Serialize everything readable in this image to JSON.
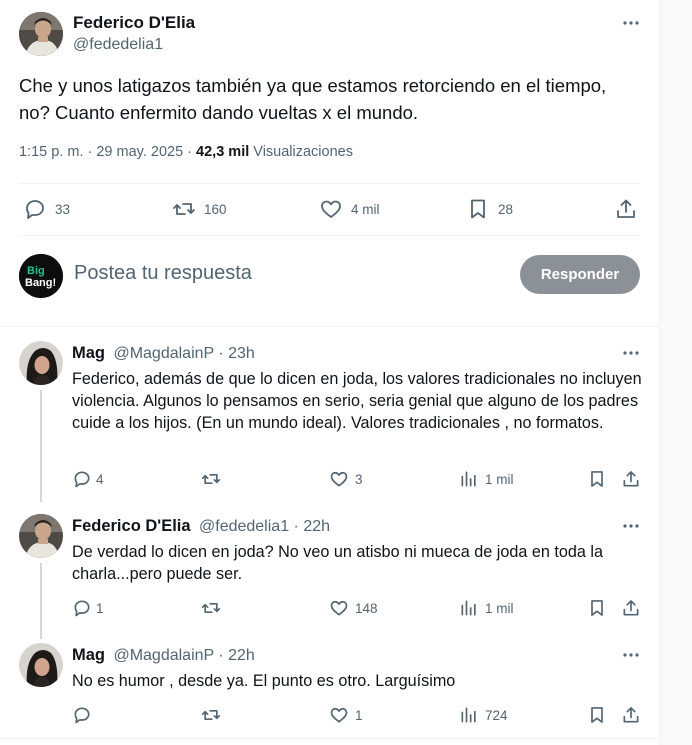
{
  "main_post": {
    "author_name": "Federico D'Elia",
    "author_handle": "@fededelia1",
    "text": "Che y unos latigazos también ya que estamos retorciendo en el tiempo, no? Cuanto enfermito dando vueltas x el mundo.",
    "time": "1:15 p. m. · 29 may. 2025 · ",
    "views_count": "42,3 mil",
    "views_label": " Visualizaciones",
    "replies": "33",
    "reposts": "160",
    "likes": "4 mil",
    "bookmarks": "28"
  },
  "reply_box": {
    "placeholder": "Postea tu respuesta",
    "button_label": "Responder",
    "avatar_logo_line1": "Big",
    "avatar_logo_line2": "Bang!"
  },
  "replies": [
    {
      "name": "Mag",
      "handle": "@MagdalainP",
      "time": " · 23h",
      "text": "Federico, además de que lo dicen en joda, los valores tradicionales no incluyen violencia. Algunos lo pensamos en serio, seria genial que alguno de los padres cuide a los hijos. (En un mundo ideal). Valores tradicionales , no formatos.",
      "replies": "4",
      "reposts": "",
      "likes": "3",
      "views": "1 mil"
    },
    {
      "name": "Federico D'Elia",
      "handle": "@fededelia1",
      "time": " · 22h",
      "text": "De verdad lo dicen en joda? No veo un atisbo ni mueca de joda en toda la charla...pero puede ser.",
      "replies": "1",
      "reposts": "",
      "likes": "148",
      "views": "1 mil"
    },
    {
      "name": "Mag",
      "handle": "@MagdalainP",
      "time": " · 22h",
      "text": "No es humor , desde ya. El punto es otro. Larguísimo",
      "replies": "",
      "reposts": "",
      "likes": "1",
      "views": "724"
    }
  ],
  "colors": {
    "text_primary": "#0f1419",
    "text_secondary": "#536471",
    "button_disabled": "#8b9196",
    "divider": "#eff3f4",
    "thread_line": "#cfd9de"
  }
}
